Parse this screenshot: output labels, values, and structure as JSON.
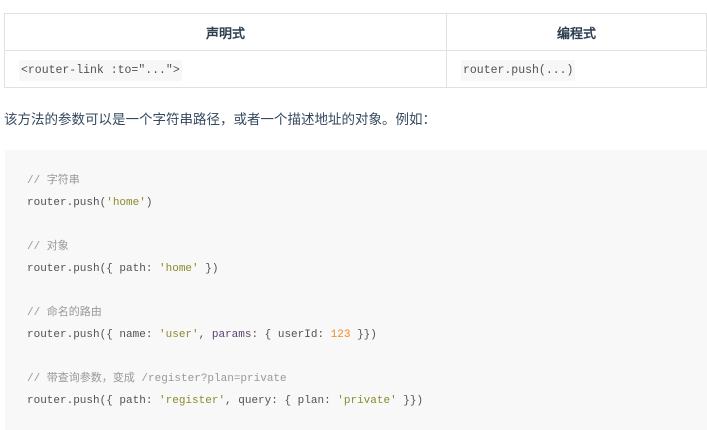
{
  "table": {
    "headers": [
      "声明式",
      "编程式"
    ],
    "row": [
      "<router-link :to=\"...\">",
      "router.push(...)"
    ]
  },
  "paragraph": "该方法的参数可以是一个字符串路径，或者一个描述地址的对象。例如：",
  "code_lines": [
    [
      {
        "t": "// 字符串",
        "c": "c"
      }
    ],
    [
      {
        "t": "router.push(",
        "c": ""
      },
      {
        "t": "'home'",
        "c": "s"
      },
      {
        "t": ")",
        "c": ""
      }
    ],
    [],
    [
      {
        "t": "// 对象",
        "c": "c"
      }
    ],
    [
      {
        "t": "router.push({ path: ",
        "c": ""
      },
      {
        "t": "'home'",
        "c": "s"
      },
      {
        "t": " })",
        "c": ""
      }
    ],
    [],
    [
      {
        "t": "// 命名的路由",
        "c": "c"
      }
    ],
    [
      {
        "t": "router.push({ name: ",
        "c": ""
      },
      {
        "t": "'user'",
        "c": "s"
      },
      {
        "t": ", ",
        "c": ""
      },
      {
        "t": "params",
        "c": "k"
      },
      {
        "t": ": { userId: ",
        "c": ""
      },
      {
        "t": "123",
        "c": "n"
      },
      {
        "t": " }})",
        "c": ""
      }
    ],
    [],
    [
      {
        "t": "// 带查询参数，变成 /register?plan=private",
        "c": "c"
      }
    ],
    [
      {
        "t": "router.push({ path: ",
        "c": ""
      },
      {
        "t": "'register'",
        "c": "s"
      },
      {
        "t": ", query: { plan: ",
        "c": ""
      },
      {
        "t": "'private'",
        "c": "s"
      },
      {
        "t": " }})",
        "c": ""
      }
    ]
  ]
}
